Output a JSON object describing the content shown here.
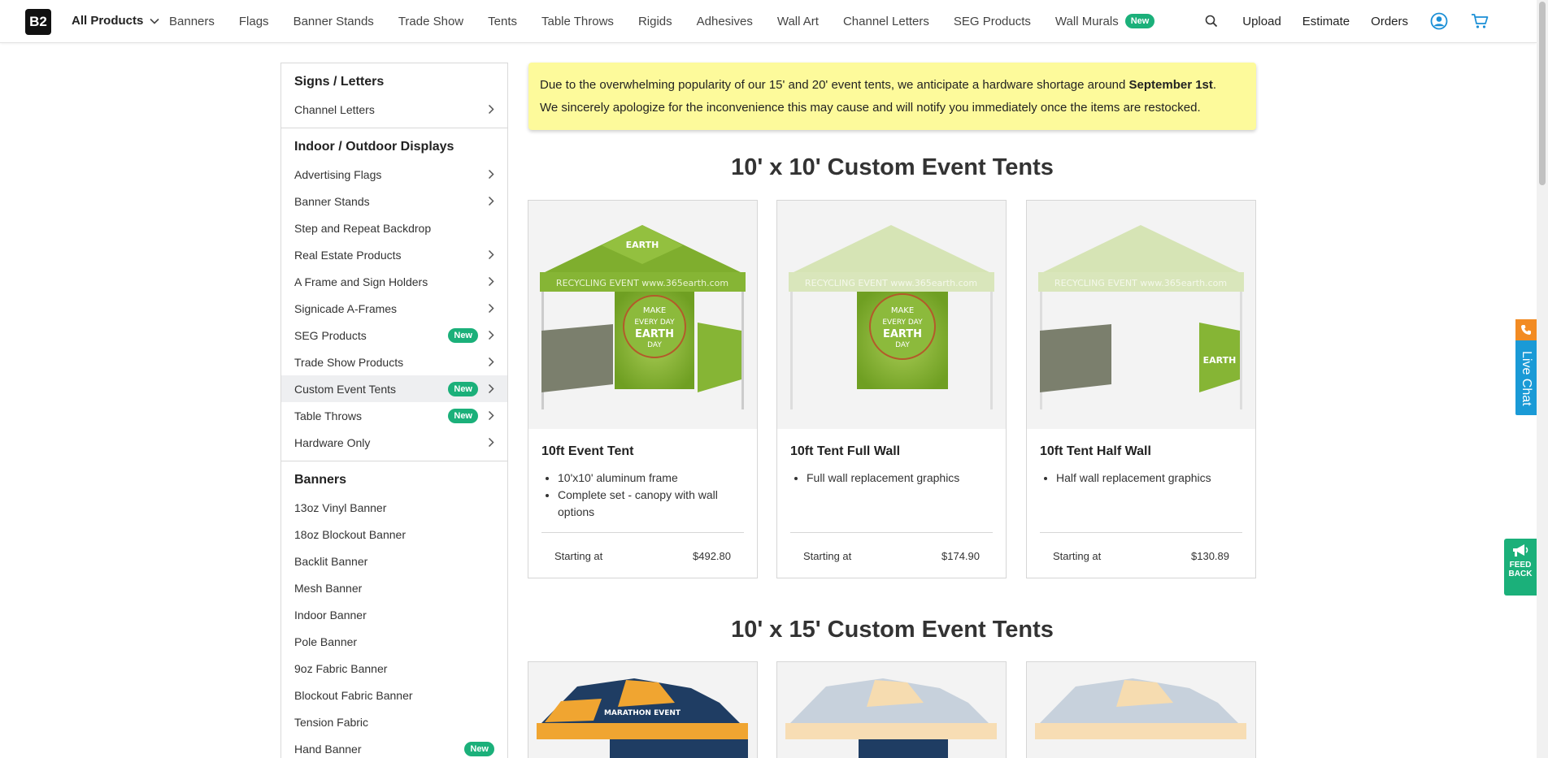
{
  "brand": {
    "logo_text": "B2"
  },
  "topnav": {
    "all_products": "All Products",
    "links": [
      "Banners",
      "Flags",
      "Banner Stands",
      "Trade Show",
      "Tents",
      "Table Throws",
      "Rigids",
      "Adhesives",
      "Wall Art",
      "Channel Letters",
      "SEG Products",
      "Wall Murals"
    ],
    "wall_murals_badge": "New",
    "upload": "Upload",
    "estimate": "Estimate",
    "orders": "Orders"
  },
  "sidebar": {
    "sections": [
      {
        "head": "Signs / Letters",
        "items": [
          {
            "label": "Channel Letters"
          }
        ]
      },
      {
        "head": "Indoor / Outdoor Displays",
        "items": [
          {
            "label": "Advertising Flags"
          },
          {
            "label": "Banner Stands"
          },
          {
            "label": "Step and Repeat Backdrop"
          },
          {
            "label": "Real Estate Products"
          },
          {
            "label": "A Frame and Sign Holders"
          },
          {
            "label": "Signicade A-Frames"
          },
          {
            "label": "SEG Products",
            "badge": "New"
          },
          {
            "label": "Trade Show Products"
          },
          {
            "label": "Custom Event Tents",
            "badge": "New"
          },
          {
            "label": "Table Throws",
            "badge": "New"
          },
          {
            "label": "Hardware Only"
          }
        ]
      },
      {
        "head": "Banners",
        "items": [
          {
            "label": "13oz Vinyl Banner"
          },
          {
            "label": "18oz Blockout Banner"
          },
          {
            "label": "Backlit Banner"
          },
          {
            "label": "Mesh Banner"
          },
          {
            "label": "Indoor Banner"
          },
          {
            "label": "Pole Banner"
          },
          {
            "label": "9oz Fabric Banner"
          },
          {
            "label": "Blockout Fabric Banner"
          },
          {
            "label": "Tension Fabric"
          },
          {
            "label": "Hand Banner",
            "badge": "New"
          }
        ]
      }
    ]
  },
  "notice": {
    "line1_pre": "Due to the overwhelming popularity of our 15' and 20' event tents, we anticipate a hardware shortage around ",
    "line1_bold": "September 1st",
    "line1_post": ".",
    "line2": "We sincerely apologize for the inconvenience this may cause and will notify you immediately once the items are restocked."
  },
  "sections": [
    {
      "title": "10' x 10' Custom Event Tents"
    },
    {
      "title": "10' x 15' Custom Event Tents"
    }
  ],
  "products": [
    {
      "title": "10ft Event Tent",
      "bullets": [
        "10'x10' aluminum frame",
        "Complete set - canopy with wall options"
      ],
      "starting_label": "Starting at",
      "price": "$492.80"
    },
    {
      "title": "10ft Tent Full Wall",
      "bullets": [
        "Full wall replacement graphics"
      ],
      "starting_label": "Starting at",
      "price": "$174.90"
    },
    {
      "title": "10ft Tent Half Wall",
      "bullets": [
        "Half wall replacement graphics"
      ],
      "starting_label": "Starting at",
      "price": "$130.89"
    }
  ],
  "tent_art": {
    "banner_text": "RECYCLING EVENT www.365earth.com",
    "make": "MAKE",
    "every_day": "EVERY DAY",
    "earth": "EARTH",
    "day": "DAY",
    "marathon": "MARATHON EVENT"
  },
  "widgets": {
    "live_chat": "Live Chat",
    "feedback_line1": "FEED",
    "feedback_line2": "BACK"
  },
  "colors": {
    "accent_green": "#1bb07a",
    "notice_bg": "#fdfa9b",
    "tent_green": "#7fae2e",
    "livechat_blue": "#1a9ad6",
    "phone_orange": "#f28b23"
  }
}
